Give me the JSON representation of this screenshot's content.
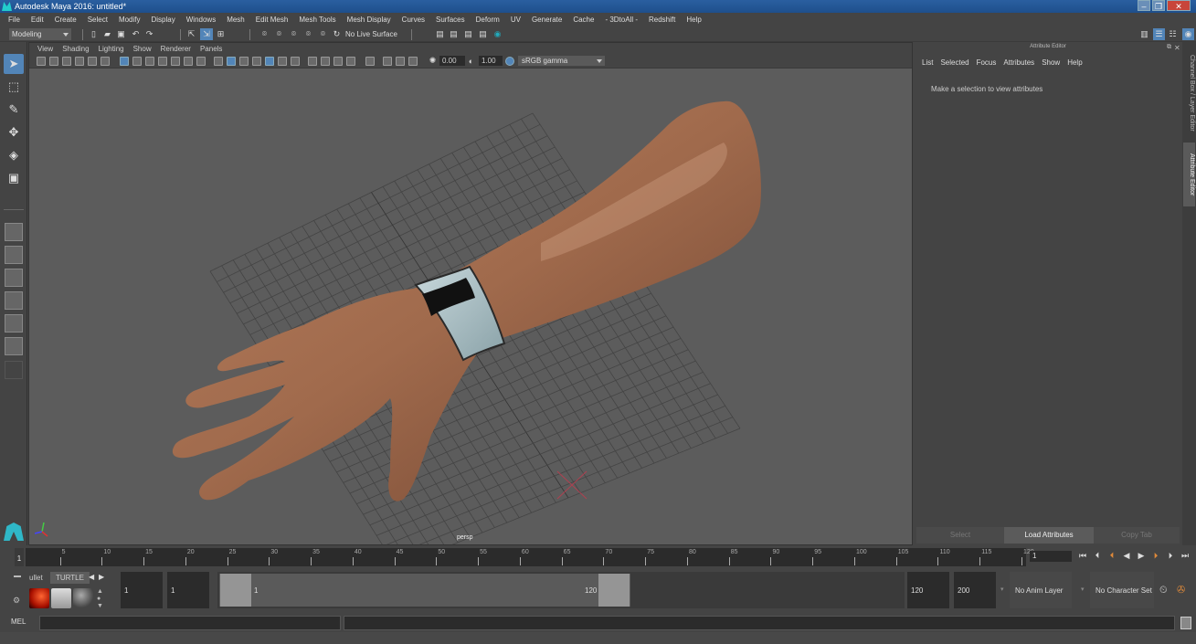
{
  "window": {
    "title": "Autodesk Maya 2016: untitled*",
    "controls": [
      "minimize",
      "maximize",
      "close"
    ]
  },
  "menubar": [
    "File",
    "Edit",
    "Create",
    "Select",
    "Modify",
    "Display",
    "Windows",
    "Mesh",
    "Edit Mesh",
    "Mesh Tools",
    "Mesh Display",
    "Curves",
    "Surfaces",
    "Deform",
    "UV",
    "Generate",
    "Cache",
    "- 3DtoAll -",
    "Redshift",
    "Help"
  ],
  "statusline": {
    "menu_set": "Modeling",
    "live_surface": "No Live Surface"
  },
  "viewport": {
    "menu": [
      "View",
      "Shading",
      "Lighting",
      "Show",
      "Renderer",
      "Panels"
    ],
    "exposure": "0.00",
    "gamma": "1.00",
    "color_space": "sRGB gamma",
    "camera_label": "persp"
  },
  "attribute_editor": {
    "title": "Attribute Editor",
    "menu": [
      "List",
      "Selected",
      "Focus",
      "Attributes",
      "Show",
      "Help"
    ],
    "message": "Make a selection to view attributes",
    "buttons": {
      "select": "Select",
      "load": "Load Attributes",
      "copy": "Copy Tab"
    }
  },
  "side_tabs": {
    "channel_box": "Channel Box / Layer Editor",
    "attribute_editor": "Attribute Editor"
  },
  "timeline": {
    "current_frame": "1",
    "ticks": [
      "5",
      "10",
      "15",
      "20",
      "25",
      "30",
      "35",
      "40",
      "45",
      "50",
      "55",
      "60",
      "65",
      "70",
      "75",
      "80",
      "85",
      "90",
      "95",
      "100",
      "105",
      "110",
      "115",
      "120"
    ],
    "frame_field": "1"
  },
  "shelf": {
    "tabs": [
      "ullet",
      "TURTLE"
    ],
    "active_tab": "TURTLE"
  },
  "range": {
    "start": "1",
    "playback_start": "1",
    "slider_start": "1",
    "slider_end": "120",
    "playback_end": "120",
    "end": "200",
    "anim_layer": "No Anim Layer",
    "character_set": "No Character Set"
  },
  "cmdline": {
    "label": "MEL"
  }
}
